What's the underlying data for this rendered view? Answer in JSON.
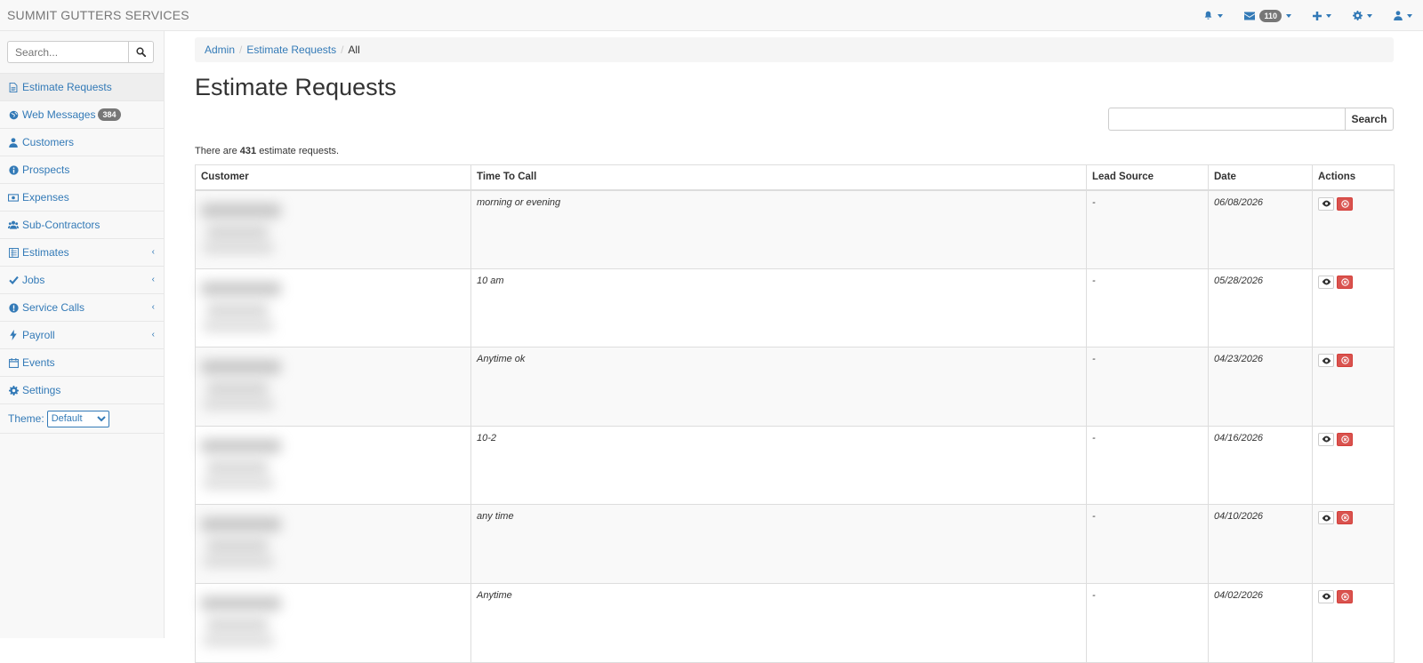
{
  "app": {
    "brand": "SUMMIT GUTTERS SERVICES"
  },
  "topnav": {
    "bell_icon": "bell-icon",
    "messages_count": "110",
    "plus_icon": "plus-icon",
    "settings_icon": "gear-icon",
    "user_icon": "user-icon"
  },
  "sidebar": {
    "search_placeholder": "Search...",
    "items": [
      {
        "label": "Estimate Requests",
        "icon": "file-icon",
        "active": true
      },
      {
        "label": "Web Messages",
        "icon": "globe-icon",
        "badge": "384"
      },
      {
        "label": "Customers",
        "icon": "user-icon"
      },
      {
        "label": "Prospects",
        "icon": "info-icon"
      },
      {
        "label": "Expenses",
        "icon": "money-icon"
      },
      {
        "label": "Sub-Contractors",
        "icon": "users-icon"
      },
      {
        "label": "Estimates",
        "icon": "list-icon",
        "expandable": true
      },
      {
        "label": "Jobs",
        "icon": "check-icon",
        "expandable": true
      },
      {
        "label": "Service Calls",
        "icon": "alert-icon",
        "expandable": true
      },
      {
        "label": "Payroll",
        "icon": "bolt-icon",
        "expandable": true
      },
      {
        "label": "Events",
        "icon": "calendar-icon"
      },
      {
        "label": "Settings",
        "icon": "gear-icon"
      }
    ],
    "theme_label": "Theme:",
    "theme_value": "Default"
  },
  "breadcrumb": {
    "items": [
      "Admin",
      "Estimate Requests"
    ],
    "current": "All"
  },
  "page": {
    "title": "Estimate Requests",
    "search_button": "Search",
    "count_prefix": "There are",
    "count": "431",
    "count_suffix": "estimate requests."
  },
  "table": {
    "headers": [
      "Customer",
      "Time To Call",
      "Lead Source",
      "Date",
      "Actions"
    ],
    "rows": [
      {
        "time_to_call": "morning or evening",
        "lead_source": "-",
        "date": "06/08/2026"
      },
      {
        "time_to_call": "10 am",
        "lead_source": "-",
        "date": "05/28/2026"
      },
      {
        "time_to_call": "Anytime ok",
        "lead_source": "-",
        "date": "04/23/2026"
      },
      {
        "time_to_call": "10-2",
        "lead_source": "-",
        "date": "04/16/2026"
      },
      {
        "time_to_call": "any time",
        "lead_source": "-",
        "date": "04/10/2026"
      },
      {
        "time_to_call": "Anytime",
        "lead_source": "-",
        "date": "04/02/2026"
      }
    ]
  },
  "colors": {
    "link": "#337ab7",
    "danger": "#d9534f",
    "badge": "#777777"
  }
}
